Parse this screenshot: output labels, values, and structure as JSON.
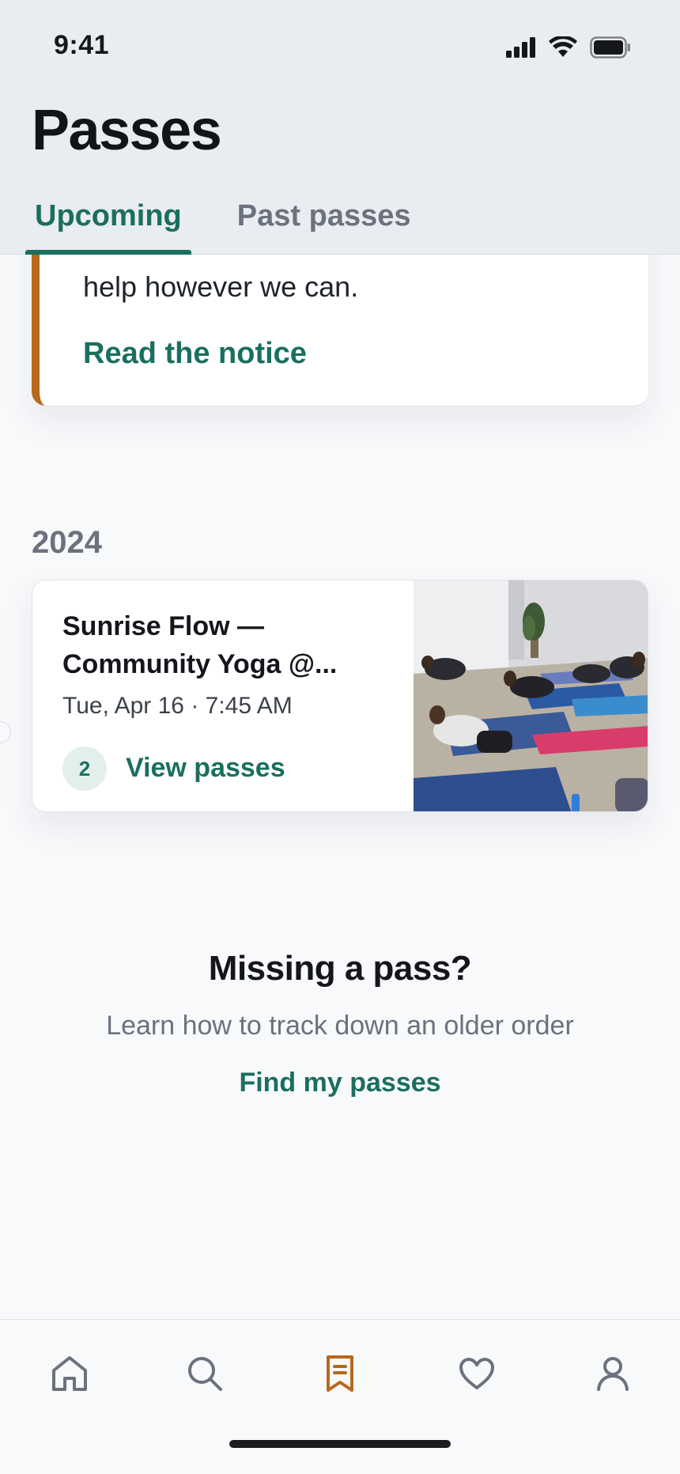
{
  "status_bar": {
    "time": "9:41"
  },
  "header": {
    "title": "Passes",
    "tabs": [
      {
        "label": "Upcoming",
        "active": true
      },
      {
        "label": "Past passes",
        "active": false
      }
    ]
  },
  "notice": {
    "body_visible": "help however we can.",
    "link_label": "Read the notice",
    "accent_color": "#b8681c"
  },
  "sections": [
    {
      "year": "2024",
      "events": [
        {
          "title": "Sunrise Flow — Community Yoga @...",
          "datetime": "Tue, Apr 16 · 7:45 AM",
          "pass_count": "2",
          "action_label": "View passes",
          "image": "yoga-class-photo"
        }
      ]
    }
  ],
  "missing": {
    "title": "Missing a pass?",
    "subtitle": "Learn how to track down an older order",
    "link_label": "Find my passes"
  },
  "bottom_nav": [
    {
      "icon": "home-icon",
      "active": false
    },
    {
      "icon": "search-icon",
      "active": false
    },
    {
      "icon": "bookmark-icon",
      "active": true
    },
    {
      "icon": "heart-icon",
      "active": false
    },
    {
      "icon": "profile-icon",
      "active": false
    }
  ],
  "colors": {
    "accent": "#1a6f5f",
    "active_nav": "#b8681c",
    "header_bg": "#e9ecf1"
  }
}
